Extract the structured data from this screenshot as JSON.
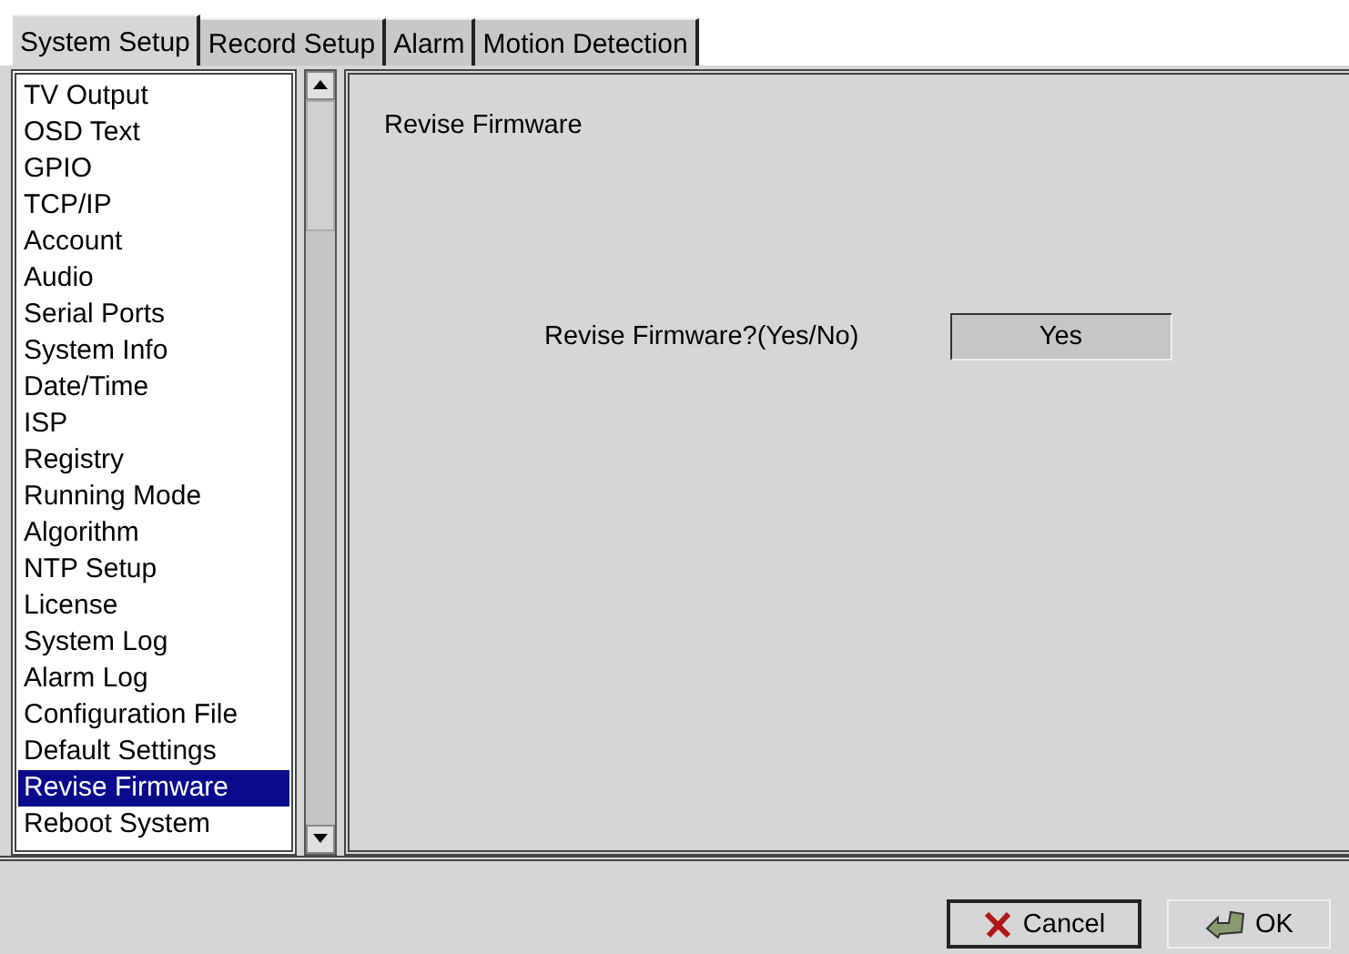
{
  "tabs": [
    {
      "label": "System Setup",
      "selected": true
    },
    {
      "label": "Record Setup",
      "selected": false
    },
    {
      "label": "Alarm",
      "selected": false
    },
    {
      "label": "Motion Detection",
      "selected": false
    }
  ],
  "sidebar": {
    "items": [
      {
        "label": "TV Output",
        "selected": false
      },
      {
        "label": "OSD Text",
        "selected": false
      },
      {
        "label": "GPIO",
        "selected": false
      },
      {
        "label": "TCP/IP",
        "selected": false
      },
      {
        "label": "Account",
        "selected": false
      },
      {
        "label": "Audio",
        "selected": false
      },
      {
        "label": "Serial Ports",
        "selected": false
      },
      {
        "label": "System Info",
        "selected": false
      },
      {
        "label": "Date/Time",
        "selected": false
      },
      {
        "label": "ISP",
        "selected": false
      },
      {
        "label": "Registry",
        "selected": false
      },
      {
        "label": "Running Mode",
        "selected": false
      },
      {
        "label": "Algorithm",
        "selected": false
      },
      {
        "label": "NTP Setup",
        "selected": false
      },
      {
        "label": "License",
        "selected": false
      },
      {
        "label": "System Log",
        "selected": false
      },
      {
        "label": "Alarm Log",
        "selected": false
      },
      {
        "label": "Configuration File",
        "selected": false
      },
      {
        "label": "Default Settings",
        "selected": false
      },
      {
        "label": "Revise Firmware",
        "selected": true
      },
      {
        "label": "Reboot System",
        "selected": false
      }
    ]
  },
  "panel": {
    "title": "Revise Firmware",
    "prompt": "Revise Firmware?(Yes/No)",
    "value": "Yes"
  },
  "buttons": {
    "cancel": "Cancel",
    "ok": "OK"
  }
}
